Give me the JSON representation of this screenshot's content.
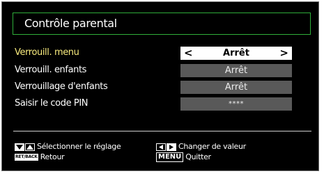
{
  "screen": {
    "title": "Contrôle parental"
  },
  "menu": {
    "rows": [
      {
        "label": "Verrouill. menu",
        "value": "Arrêt"
      },
      {
        "label": "Verrouill. enfants",
        "value": "Arrêt"
      },
      {
        "label": "Verrouillage d'enfants",
        "value": "Arrêt"
      },
      {
        "label": "Saisir le code PIN",
        "value": "****"
      }
    ],
    "nav_left": "<",
    "nav_right": ">"
  },
  "footer": {
    "select_hint": "Sélectionner le réglage",
    "change_hint": "Changer de valeur",
    "back_key": "RET/BACK",
    "back_hint": "Retour",
    "menu_key": "MENU",
    "quit_hint": "Quitter"
  },
  "colors": {
    "accent_frame": "#2fae3a",
    "selected_label": "#f7ea7d",
    "value_box": "#595959"
  }
}
